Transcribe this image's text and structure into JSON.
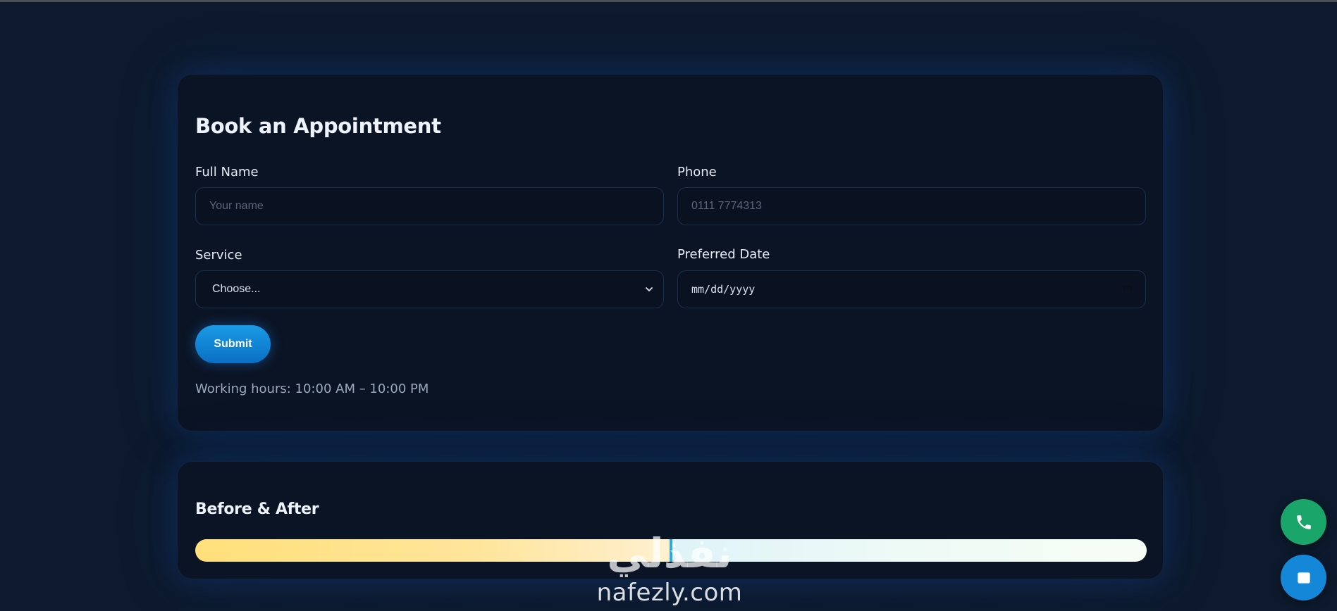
{
  "booking": {
    "title": "Book an Appointment",
    "full_name": {
      "label": "Full Name",
      "placeholder": "Your name",
      "value": ""
    },
    "phone": {
      "label": "Phone",
      "placeholder": "0111 7774313",
      "value": ""
    },
    "service": {
      "label": "Service",
      "selected": "Choose..."
    },
    "date": {
      "label": "Preferred Date",
      "format": "mm/dd/yyyy"
    },
    "submit_label": "Submit",
    "hours_text": "Working hours: 10:00 AM – 10:00 PM"
  },
  "gallery": {
    "title": "Before & After",
    "slider_position": 0.5
  },
  "floating_actions": {
    "phone_icon": "phone-icon",
    "chat_icon": "chat-icon"
  },
  "watermark": {
    "arabic": "نفذلي",
    "latin": "nafezly.com"
  },
  "colors": {
    "background": "#0d1a2d",
    "card": "#0b1424",
    "accent": "#1487d8",
    "phone_button": "#1aa66b",
    "before_color": "#ffe07a",
    "after_color": "#eefaf6"
  }
}
